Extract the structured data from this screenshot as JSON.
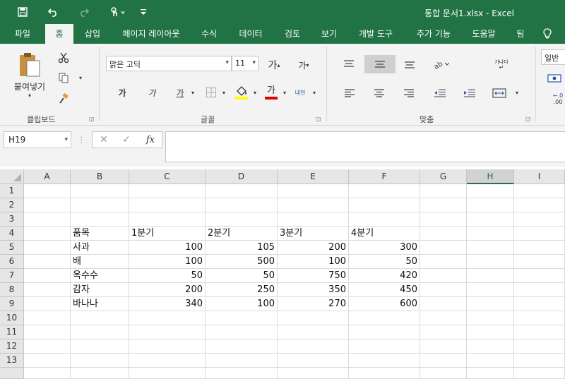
{
  "title": "통합 문서1.xlsx  -  Excel",
  "quick_access": [
    "save-icon",
    "undo-icon",
    "redo-icon",
    "touch-mode-icon",
    "customize-icon"
  ],
  "tabs": [
    {
      "label": "파일",
      "active": false
    },
    {
      "label": "홈",
      "active": true
    },
    {
      "label": "삽입",
      "active": false
    },
    {
      "label": "페이지 레이아웃",
      "active": false
    },
    {
      "label": "수식",
      "active": false
    },
    {
      "label": "데이터",
      "active": false
    },
    {
      "label": "검토",
      "active": false
    },
    {
      "label": "보기",
      "active": false
    },
    {
      "label": "개발 도구",
      "active": false
    },
    {
      "label": "추가 기능",
      "active": false
    },
    {
      "label": "도움말",
      "active": false
    },
    {
      "label": "팀",
      "active": false
    }
  ],
  "ribbon": {
    "clipboard": {
      "paste_label": "붙여넣기",
      "group_label": "클립보드"
    },
    "font": {
      "font_name": "맑은 고딕",
      "font_size": "11",
      "grow_label": "가",
      "shrink_label": "가",
      "bold_label": "가",
      "italic_label": "가",
      "underline_label": "가",
      "font_color_label": "가",
      "phonetic_label": "내천",
      "group_label": "글꼴"
    },
    "alignment": {
      "wrap_label": "가나다",
      "group_label": "맞춤"
    },
    "number": {
      "format_label": "일반"
    }
  },
  "formula_bar": {
    "name_box": "H19",
    "fx_label": "fx",
    "formula": ""
  },
  "grid": {
    "columns": [
      "A",
      "B",
      "C",
      "D",
      "E",
      "F",
      "G",
      "H",
      "I"
    ],
    "selected_column": "H",
    "rows": [
      "1",
      "2",
      "3",
      "4",
      "5",
      "6",
      "7",
      "8",
      "9",
      "10",
      "11",
      "12",
      "13"
    ],
    "header_row": [
      "품목",
      "1분기",
      "2분기",
      "3분기",
      "4분기"
    ],
    "data": [
      {
        "item": "사과",
        "q1": "100",
        "q2": "105",
        "q3": "200",
        "q4": "300"
      },
      {
        "item": "배",
        "q1": "100",
        "q2": "500",
        "q3": "100",
        "q4": "50"
      },
      {
        "item": "옥수수",
        "q1": "50",
        "q2": "50",
        "q3": "750",
        "q4": "420"
      },
      {
        "item": "감자",
        "q1": "200",
        "q2": "250",
        "q3": "350",
        "q4": "450"
      },
      {
        "item": "바나나",
        "q1": "340",
        "q2": "100",
        "q3": "270",
        "q4": "600"
      }
    ]
  },
  "colors": {
    "brand": "#217346",
    "ribbon": "#f3f3f3",
    "grid_line": "#dadada"
  }
}
